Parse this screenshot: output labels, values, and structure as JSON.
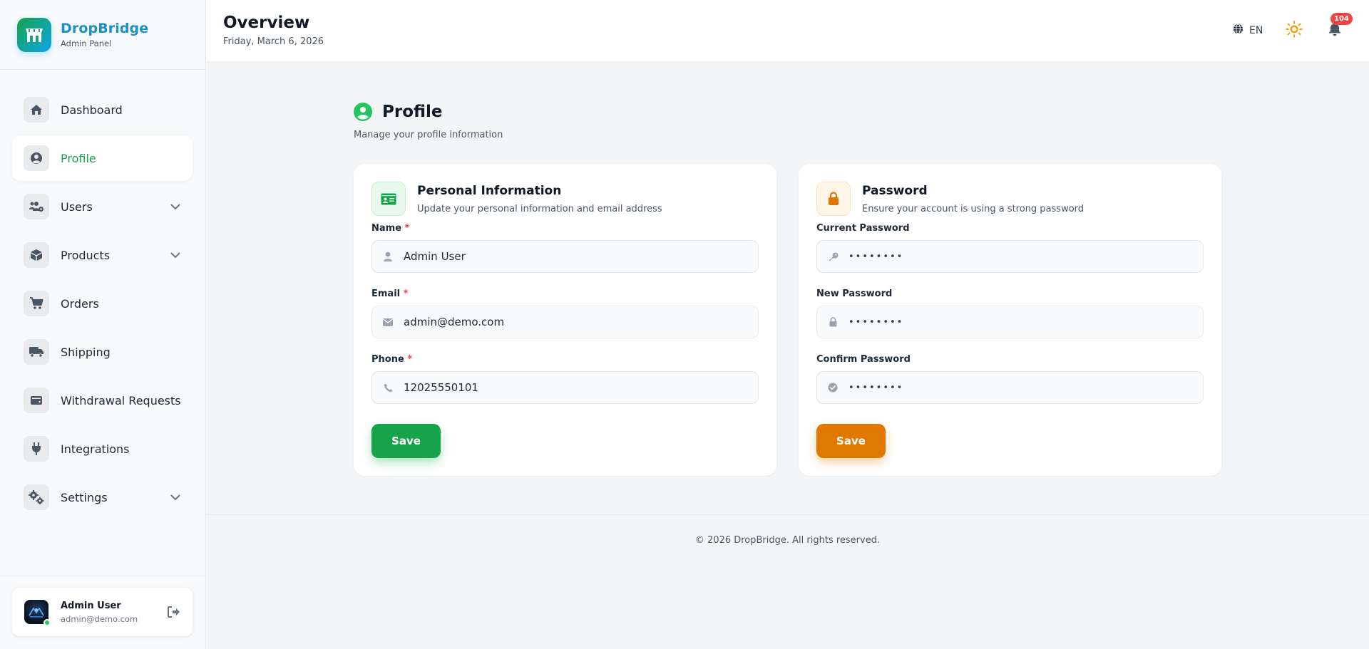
{
  "brand": {
    "name": "DropBridge",
    "subtitle": "Admin Panel"
  },
  "sidebar": {
    "items": [
      {
        "label": "Dashboard",
        "icon": "home-icon",
        "active": false,
        "expandable": false
      },
      {
        "label": "Profile",
        "icon": "user-circle-icon",
        "active": true,
        "expandable": false
      },
      {
        "label": "Users",
        "icon": "users-cog-icon",
        "active": false,
        "expandable": true
      },
      {
        "label": "Products",
        "icon": "box-icon",
        "active": false,
        "expandable": true
      },
      {
        "label": "Orders",
        "icon": "cart-icon",
        "active": false,
        "expandable": false
      },
      {
        "label": "Shipping",
        "icon": "truck-icon",
        "active": false,
        "expandable": false
      },
      {
        "label": "Withdrawal Requests",
        "icon": "wallet-icon",
        "active": false,
        "expandable": false
      },
      {
        "label": "Integrations",
        "icon": "plug-icon",
        "active": false,
        "expandable": false
      },
      {
        "label": "Settings",
        "icon": "cogs-icon",
        "active": false,
        "expandable": true
      }
    ]
  },
  "user": {
    "name": "Admin User",
    "email": "admin@demo.com",
    "status": "online"
  },
  "header": {
    "title": "Overview",
    "date": "Friday, March 6, 2026",
    "language": "EN",
    "notifications_count": "104"
  },
  "page": {
    "title": "Profile",
    "subtitle": "Manage your profile information"
  },
  "personal": {
    "title": "Personal Information",
    "subtitle": "Update your personal information and email address",
    "name_label": "Name",
    "name_value": "Admin User",
    "email_label": "Email",
    "email_value": "admin@demo.com",
    "phone_label": "Phone",
    "phone_value": "12025550101",
    "required_mark": "*",
    "save_label": "Save"
  },
  "password": {
    "title": "Password",
    "subtitle": "Ensure your account is using a strong password",
    "current_label": "Current Password",
    "current_value": "••••••••",
    "new_label": "New Password",
    "new_value": "••••••••",
    "confirm_label": "Confirm Password",
    "confirm_value": "••••••••",
    "save_label": "Save"
  },
  "footer": {
    "text": "© 2026 DropBridge. All rights reserved."
  },
  "colors": {
    "accent_green": "#16a34a",
    "accent_orange": "#e07800",
    "brand_blue": "#1c8fc4",
    "badge_red": "#ef4444"
  }
}
